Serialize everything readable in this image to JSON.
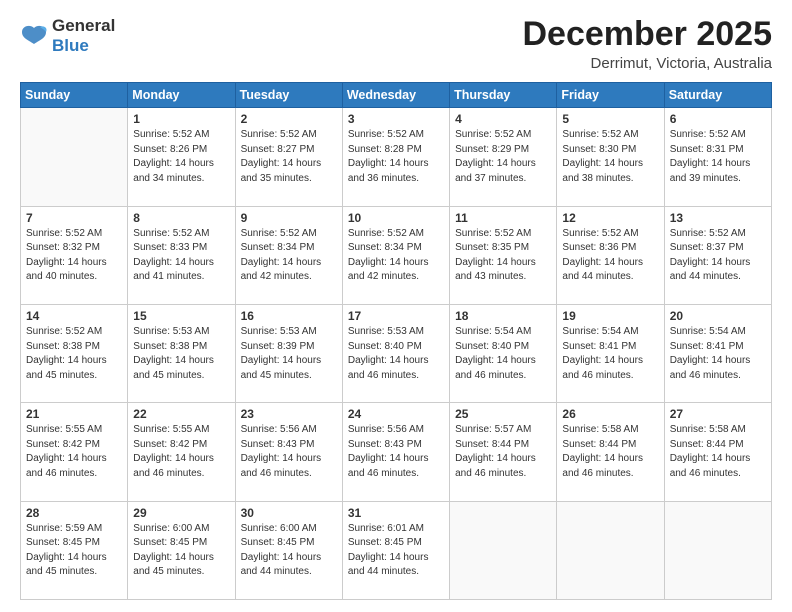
{
  "logo": {
    "line1": "General",
    "line2": "Blue"
  },
  "header": {
    "month": "December 2025",
    "location": "Derrimut, Victoria, Australia"
  },
  "weekdays": [
    "Sunday",
    "Monday",
    "Tuesday",
    "Wednesday",
    "Thursday",
    "Friday",
    "Saturday"
  ],
  "weeks": [
    [
      {
        "day": "",
        "info": ""
      },
      {
        "day": "1",
        "info": "Sunrise: 5:52 AM\nSunset: 8:26 PM\nDaylight: 14 hours\nand 34 minutes."
      },
      {
        "day": "2",
        "info": "Sunrise: 5:52 AM\nSunset: 8:27 PM\nDaylight: 14 hours\nand 35 minutes."
      },
      {
        "day": "3",
        "info": "Sunrise: 5:52 AM\nSunset: 8:28 PM\nDaylight: 14 hours\nand 36 minutes."
      },
      {
        "day": "4",
        "info": "Sunrise: 5:52 AM\nSunset: 8:29 PM\nDaylight: 14 hours\nand 37 minutes."
      },
      {
        "day": "5",
        "info": "Sunrise: 5:52 AM\nSunset: 8:30 PM\nDaylight: 14 hours\nand 38 minutes."
      },
      {
        "day": "6",
        "info": "Sunrise: 5:52 AM\nSunset: 8:31 PM\nDaylight: 14 hours\nand 39 minutes."
      }
    ],
    [
      {
        "day": "7",
        "info": "Sunrise: 5:52 AM\nSunset: 8:32 PM\nDaylight: 14 hours\nand 40 minutes."
      },
      {
        "day": "8",
        "info": "Sunrise: 5:52 AM\nSunset: 8:33 PM\nDaylight: 14 hours\nand 41 minutes."
      },
      {
        "day": "9",
        "info": "Sunrise: 5:52 AM\nSunset: 8:34 PM\nDaylight: 14 hours\nand 42 minutes."
      },
      {
        "day": "10",
        "info": "Sunrise: 5:52 AM\nSunset: 8:34 PM\nDaylight: 14 hours\nand 42 minutes."
      },
      {
        "day": "11",
        "info": "Sunrise: 5:52 AM\nSunset: 8:35 PM\nDaylight: 14 hours\nand 43 minutes."
      },
      {
        "day": "12",
        "info": "Sunrise: 5:52 AM\nSunset: 8:36 PM\nDaylight: 14 hours\nand 44 minutes."
      },
      {
        "day": "13",
        "info": "Sunrise: 5:52 AM\nSunset: 8:37 PM\nDaylight: 14 hours\nand 44 minutes."
      }
    ],
    [
      {
        "day": "14",
        "info": "Sunrise: 5:52 AM\nSunset: 8:38 PM\nDaylight: 14 hours\nand 45 minutes."
      },
      {
        "day": "15",
        "info": "Sunrise: 5:53 AM\nSunset: 8:38 PM\nDaylight: 14 hours\nand 45 minutes."
      },
      {
        "day": "16",
        "info": "Sunrise: 5:53 AM\nSunset: 8:39 PM\nDaylight: 14 hours\nand 45 minutes."
      },
      {
        "day": "17",
        "info": "Sunrise: 5:53 AM\nSunset: 8:40 PM\nDaylight: 14 hours\nand 46 minutes."
      },
      {
        "day": "18",
        "info": "Sunrise: 5:54 AM\nSunset: 8:40 PM\nDaylight: 14 hours\nand 46 minutes."
      },
      {
        "day": "19",
        "info": "Sunrise: 5:54 AM\nSunset: 8:41 PM\nDaylight: 14 hours\nand 46 minutes."
      },
      {
        "day": "20",
        "info": "Sunrise: 5:54 AM\nSunset: 8:41 PM\nDaylight: 14 hours\nand 46 minutes."
      }
    ],
    [
      {
        "day": "21",
        "info": "Sunrise: 5:55 AM\nSunset: 8:42 PM\nDaylight: 14 hours\nand 46 minutes."
      },
      {
        "day": "22",
        "info": "Sunrise: 5:55 AM\nSunset: 8:42 PM\nDaylight: 14 hours\nand 46 minutes."
      },
      {
        "day": "23",
        "info": "Sunrise: 5:56 AM\nSunset: 8:43 PM\nDaylight: 14 hours\nand 46 minutes."
      },
      {
        "day": "24",
        "info": "Sunrise: 5:56 AM\nSunset: 8:43 PM\nDaylight: 14 hours\nand 46 minutes."
      },
      {
        "day": "25",
        "info": "Sunrise: 5:57 AM\nSunset: 8:44 PM\nDaylight: 14 hours\nand 46 minutes."
      },
      {
        "day": "26",
        "info": "Sunrise: 5:58 AM\nSunset: 8:44 PM\nDaylight: 14 hours\nand 46 minutes."
      },
      {
        "day": "27",
        "info": "Sunrise: 5:58 AM\nSunset: 8:44 PM\nDaylight: 14 hours\nand 46 minutes."
      }
    ],
    [
      {
        "day": "28",
        "info": "Sunrise: 5:59 AM\nSunset: 8:45 PM\nDaylight: 14 hours\nand 45 minutes."
      },
      {
        "day": "29",
        "info": "Sunrise: 6:00 AM\nSunset: 8:45 PM\nDaylight: 14 hours\nand 45 minutes."
      },
      {
        "day": "30",
        "info": "Sunrise: 6:00 AM\nSunset: 8:45 PM\nDaylight: 14 hours\nand 44 minutes."
      },
      {
        "day": "31",
        "info": "Sunrise: 6:01 AM\nSunset: 8:45 PM\nDaylight: 14 hours\nand 44 minutes."
      },
      {
        "day": "",
        "info": ""
      },
      {
        "day": "",
        "info": ""
      },
      {
        "day": "",
        "info": ""
      }
    ]
  ]
}
